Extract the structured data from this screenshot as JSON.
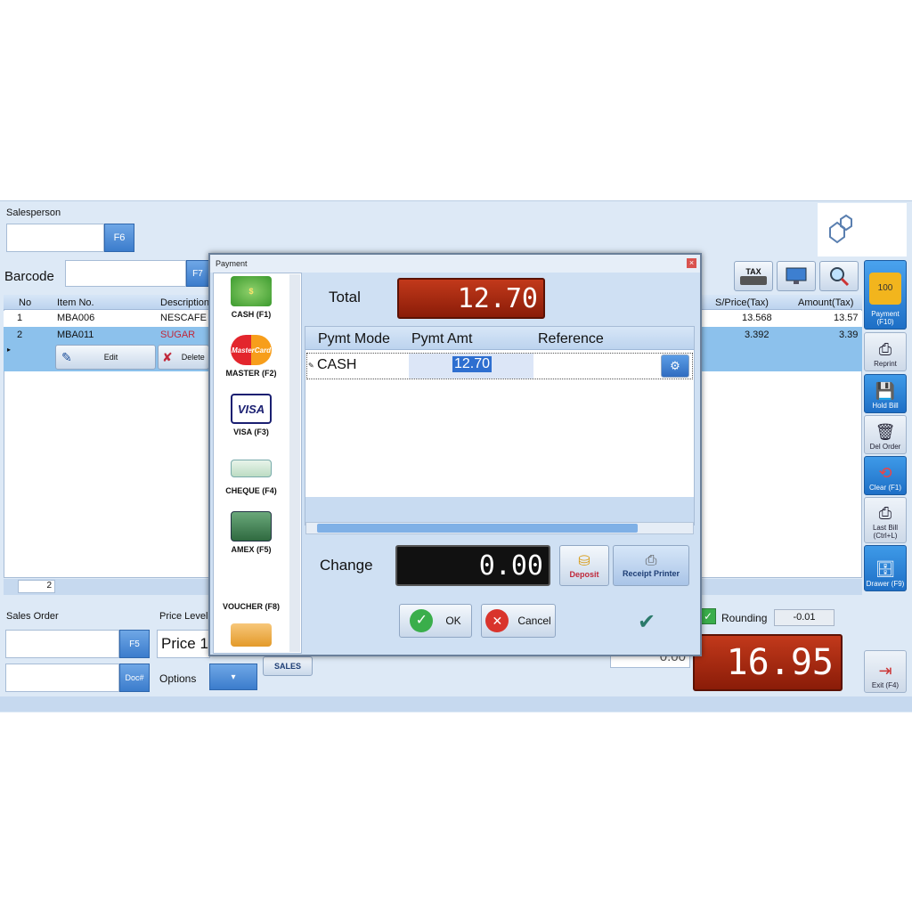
{
  "header": {
    "salesperson_label": "Salesperson",
    "salesperson_value": "",
    "salesperson_key": "F6",
    "barcode_label": "Barcode",
    "barcode_value": "",
    "barcode_key": "F7"
  },
  "grid": {
    "columns": [
      "No",
      "Item No.",
      "Description",
      "S/Price(Tax)",
      "Amount(Tax)"
    ],
    "rows": [
      {
        "no": "1",
        "item": "MBA006",
        "desc": "NESCAFE",
        "price": "13.568",
        "amount": "13.57"
      },
      {
        "no": "2",
        "item": "MBA011",
        "desc": "SUGAR",
        "price": "3.392",
        "amount": "3.39"
      }
    ],
    "edit_label": "Edit",
    "delete_label": "Delete",
    "count": "2"
  },
  "footer": {
    "sales_order_label": "Sales Order",
    "sales_order_key": "F5",
    "doc_key": "Doc#",
    "price_level_label": "Price Level",
    "price_level_value": "Price 1",
    "options_label": "Options",
    "options_value": "▾",
    "sales_label": "SALES",
    "rounding_label": "Rounding",
    "rounding_value": "-0.01",
    "grand_total": "16.95",
    "hidden_value": "0.00"
  },
  "sidebar": {
    "items": [
      {
        "label": "Payment (F10)"
      },
      {
        "label": "Reprint"
      },
      {
        "label": "Hold Bill"
      },
      {
        "label": "Del Order"
      },
      {
        "label": "Clear (F1)"
      },
      {
        "label": "Last Bill (Ctrl+L)"
      },
      {
        "label": "Drawer (F9)"
      },
      {
        "label": "Exit (F4)"
      }
    ]
  },
  "toolbar": {
    "tax_label": "TAX"
  },
  "dialog": {
    "title": "Payment",
    "close_glyph": "×",
    "total_label": "Total",
    "total_value": "12.70",
    "columns": [
      "Pymt Mode",
      "Pymt Amt",
      "Reference"
    ],
    "row": {
      "mode": "CASH",
      "amount": "12.70",
      "reference": ""
    },
    "change_label": "Change",
    "change_value": "0.00",
    "deposit_label": "Deposit",
    "receipt_label": "Receipt Printer",
    "ok_label": "OK",
    "cancel_label": "Cancel",
    "methods": [
      {
        "label": "CASH (F1)"
      },
      {
        "label": "MASTER (F2)"
      },
      {
        "label": "VISA (F3)"
      },
      {
        "label": "CHEQUE (F4)"
      },
      {
        "label": "AMEX (F5)"
      },
      {
        "label": "VOUCHER (F8)"
      }
    ],
    "mastercard_text": "MasterCard",
    "visa_text": "VISA"
  }
}
